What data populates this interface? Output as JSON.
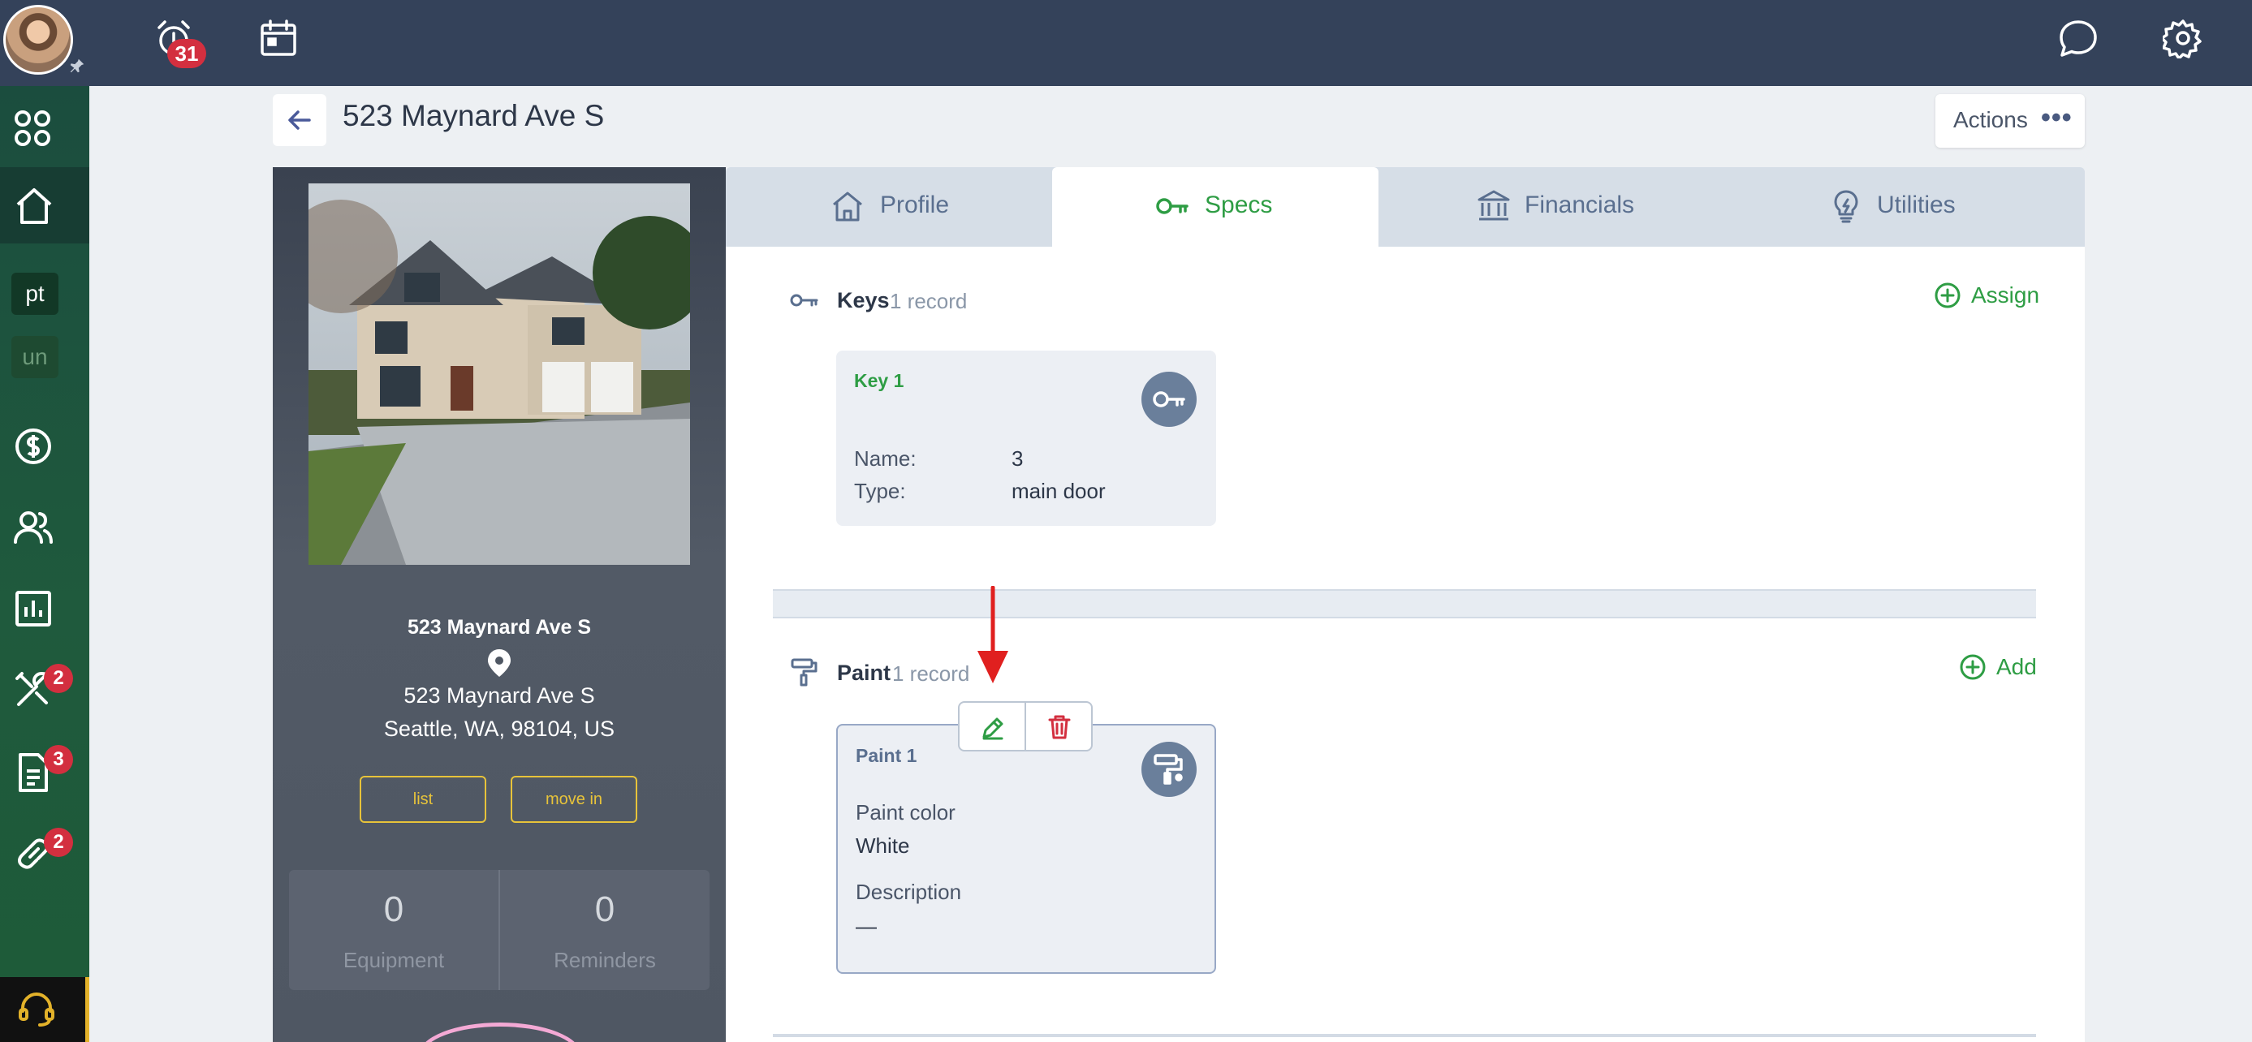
{
  "topbar": {
    "alarm_count": "31"
  },
  "sidebar": {
    "chips": [
      "pt",
      "un"
    ],
    "badges": {
      "tools": "2",
      "documents": "3",
      "links": "2"
    }
  },
  "header": {
    "title": "523 Maynard Ave S",
    "actions_label": "Actions"
  },
  "property": {
    "name": "523 Maynard Ave S",
    "address_line1": "523 Maynard Ave S",
    "address_line2": "Seattle, WA, 98104, US",
    "buttons": [
      "list",
      "move in"
    ],
    "stats": [
      {
        "value": "0",
        "label": "Equipment"
      },
      {
        "value": "0",
        "label": "Reminders"
      }
    ]
  },
  "tabs": [
    {
      "label": "Profile",
      "icon": "house-icon",
      "active": false
    },
    {
      "label": "Specs",
      "icon": "key-icon",
      "active": true
    },
    {
      "label": "Financials",
      "icon": "bank-icon",
      "active": false
    },
    {
      "label": "Utilities",
      "icon": "lightbulb-icon",
      "active": false
    }
  ],
  "keys_section": {
    "title": "Keys",
    "count": "1 record",
    "action": "Assign",
    "card": {
      "title": "Key 1",
      "fields": [
        {
          "label": "Name:",
          "value": "3"
        },
        {
          "label": "Type:",
          "value": "main door"
        }
      ]
    }
  },
  "paint_section": {
    "title": "Paint",
    "count": "1 record",
    "action": "Add",
    "card": {
      "title": "Paint 1",
      "color_label": "Paint color",
      "color_value": "White",
      "description_label": "Description",
      "description_value": "—"
    }
  },
  "colors": {
    "topbar": "#34425a",
    "accent_green": "#2e9d44",
    "badge_red": "#d32f3f",
    "button_yellow": "#e7c33a",
    "arrow_red": "#e0201f"
  }
}
